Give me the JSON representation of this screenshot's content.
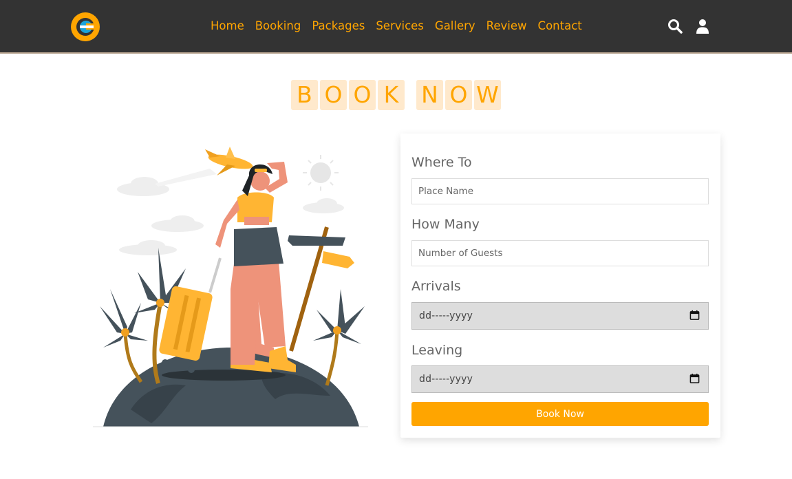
{
  "brand": {
    "logo_letter": "G",
    "accent": "#ffa500",
    "header_bg": "#333333"
  },
  "nav": {
    "items": [
      {
        "label": "Home"
      },
      {
        "label": "Booking"
      },
      {
        "label": "Packages"
      },
      {
        "label": "Services"
      },
      {
        "label": "Gallery"
      },
      {
        "label": "Review"
      },
      {
        "label": "Contact"
      }
    ],
    "icons": [
      "search-icon",
      "user-icon"
    ]
  },
  "heading": {
    "words": [
      [
        "B",
        "O",
        "O",
        "K"
      ],
      [
        "N",
        "O",
        "W"
      ]
    ]
  },
  "form": {
    "where_label": "Where To",
    "where_placeholder": "Place Name",
    "guests_label": "How Many",
    "guests_placeholder": "Number of Guests",
    "arrivals_label": "Arrivals",
    "arrivals_value": "dd-----yyyy",
    "leaving_label": "Leaving",
    "leaving_value": "dd-----yyyy",
    "submit_label": "Book Now",
    "date_field_bg": "#dddddd"
  }
}
